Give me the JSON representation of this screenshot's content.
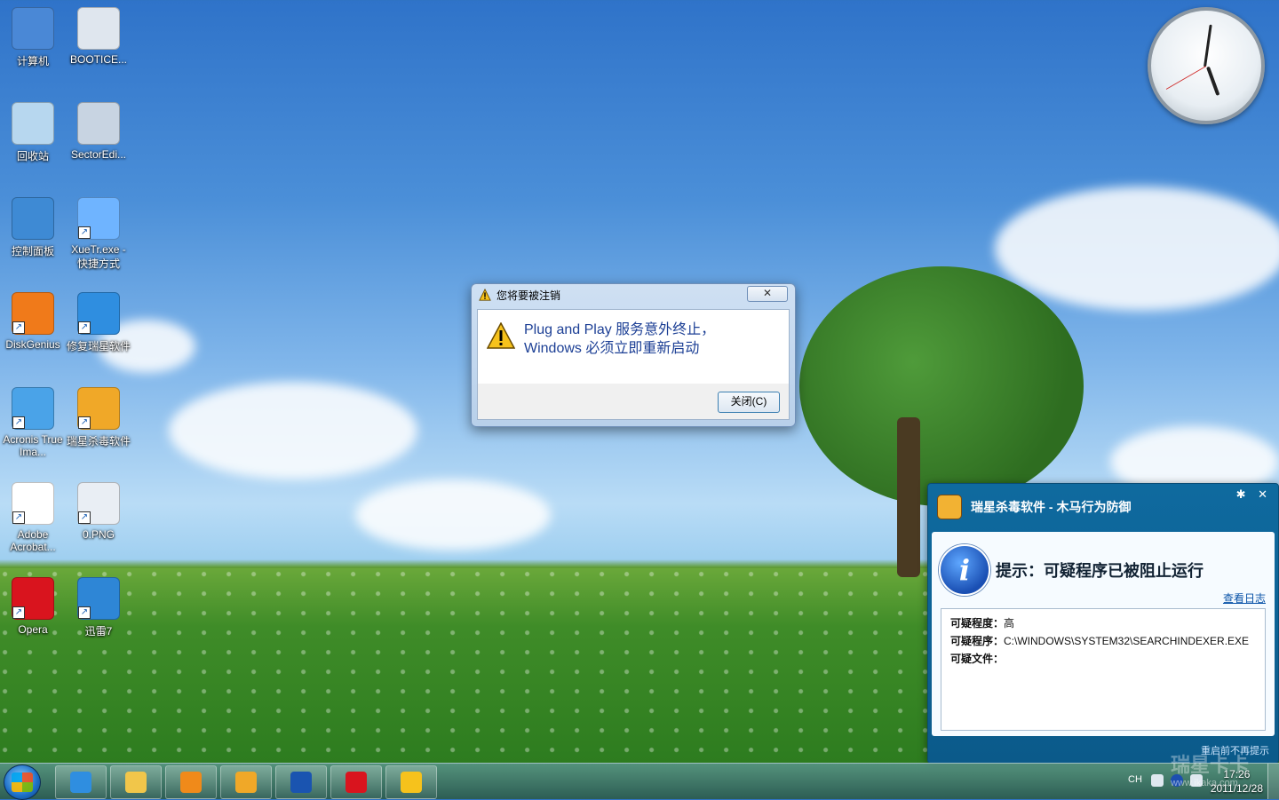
{
  "desktop_icons": [
    {
      "label": "计算机",
      "icon": "computer-icon",
      "color": "#4a88d6"
    },
    {
      "label": "BOOTICE...",
      "icon": "bootice-icon",
      "color": "#dfe6ee"
    },
    {
      "label": "回收站",
      "icon": "recycle-bin-icon",
      "color": "#b7d7ef"
    },
    {
      "label": "SectorEdi...",
      "icon": "sector-editor-icon",
      "color": "#c8d4e2"
    },
    {
      "label": "控制面板",
      "icon": "control-panel-icon",
      "color": "#3e8ad4"
    },
    {
      "label": "XueTr.exe - 快捷方式",
      "icon": "xuetr-icon",
      "color": "#6fb4ff"
    },
    {
      "label": "DiskGenius",
      "icon": "diskgenius-icon",
      "color": "#f07a1a"
    },
    {
      "label": "修复瑞星软件",
      "icon": "internet-explorer-icon",
      "color": "#2f8ee0"
    },
    {
      "label": "Acronis True Ima...",
      "icon": "acronis-icon",
      "color": "#4aa3e8"
    },
    {
      "label": "瑞星杀毒软件",
      "icon": "rising-antivirus-icon",
      "color": "#f0a828"
    },
    {
      "label": "Adobe Acrobat...",
      "icon": "adobe-acrobat-icon",
      "color": "#ffffff"
    },
    {
      "label": "0.PNG",
      "icon": "image-file-icon",
      "color": "#e9eef4"
    },
    {
      "label": "Opera",
      "icon": "opera-icon",
      "color": "#d9141e"
    },
    {
      "label": "迅雷7",
      "icon": "xunlei-icon",
      "color": "#2e86d6"
    }
  ],
  "dialog": {
    "title": "您将要被注销",
    "close_glyph": "✕",
    "message_line1": "Plug and Play 服务意外终止，",
    "message_line2": "Windows 必须立即重新启动",
    "close_button": "关闭(C)"
  },
  "rising_popup": {
    "header": "瑞星杀毒软件 - 木马行为防御",
    "settings_glyph": "✱",
    "close_glyph": "✕",
    "info_glyph": "i",
    "title": "提示：可疑程序已被阻止运行",
    "log_link": "查看日志",
    "details": [
      {
        "key": "可疑程度：",
        "value": "高"
      },
      {
        "key": "可疑程序：",
        "value": "C:\\WINDOWS\\SYSTEM32\\SEARCHINDEXER.EXE"
      },
      {
        "key": "可疑文件：",
        "value": ""
      }
    ],
    "footer": "重启前不再提示"
  },
  "taskbar": {
    "items": [
      {
        "name": "internet-explorer-task",
        "icon": "internet-explorer-icon",
        "color": "#2f8ee0"
      },
      {
        "name": "explorer-task",
        "icon": "folder-icon",
        "color": "#f1c64a"
      },
      {
        "name": "media-player-task",
        "icon": "media-player-icon",
        "color": "#f08a1a"
      },
      {
        "name": "rising-task",
        "icon": "rising-antivirus-icon",
        "color": "#f0a828"
      },
      {
        "name": "security-task",
        "icon": "shield-icon",
        "color": "#1a54b0"
      },
      {
        "name": "opera-task",
        "icon": "opera-icon",
        "color": "#d9141e"
      },
      {
        "name": "warning-task",
        "icon": "warning-icon",
        "color": "#f6c21c"
      }
    ],
    "lang": "CH",
    "time": "17:26",
    "date": "2011/12/28",
    "watermark": "瑞星卡卡",
    "watermark_url": "www.ikaka.com"
  }
}
